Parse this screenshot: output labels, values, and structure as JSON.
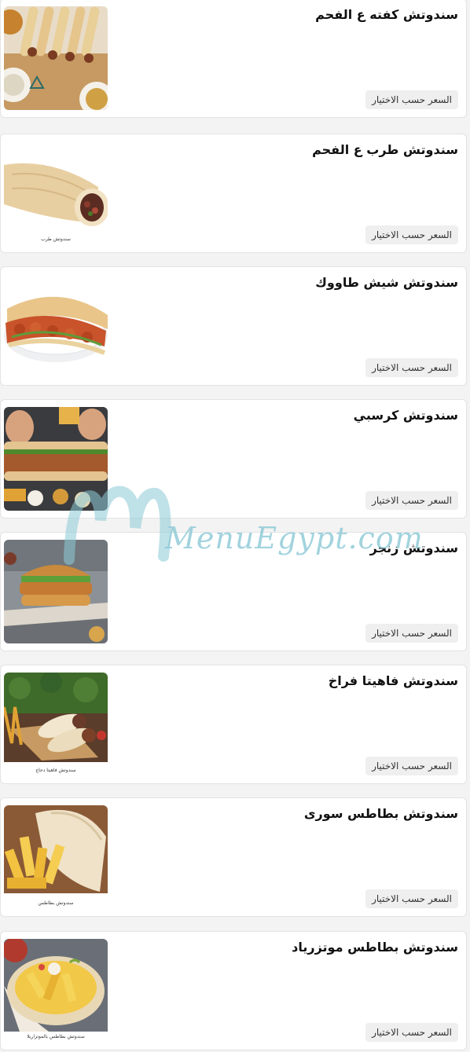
{
  "items": [
    {
      "name": "سندوتش كفته ع الفحم",
      "price_label": "السعر حسب الاختيار",
      "image": "kofta-grill-image",
      "caption": ""
    },
    {
      "name": "سندوتش طرب ع الفحم",
      "price_label": "السعر حسب الاختيار",
      "image": "tarb-wrap-image",
      "caption": "سندوتش طرب"
    },
    {
      "name": "سندوتش شيش طاووك",
      "price_label": "السعر حسب الاختيار",
      "image": "shish-tawook-image",
      "caption": ""
    },
    {
      "name": "سندوتش كرسبي",
      "price_label": "السعر حسب الاختيار",
      "image": "crispy-sandwich-image",
      "caption": ""
    },
    {
      "name": "سندوتش زنجر",
      "price_label": "السعر حسب الاختيار",
      "image": "zinger-burger-image",
      "caption": ""
    },
    {
      "name": "سندوتش فاهيتا فراخ",
      "price_label": "السعر حسب الاختيار",
      "image": "chicken-fajita-image",
      "caption": "سندوتش فاهيتا دجاج"
    },
    {
      "name": "سندوتش بطاطس سورى",
      "price_label": "السعر حسب الاختيار",
      "image": "syrian-fries-wrap-image",
      "caption": "سندوتش بطاطس"
    },
    {
      "name": "سندوتش بطاطس موتزرياد",
      "price_label": "السعر حسب الاختيار",
      "image": "fries-mozzarella-image",
      "caption": "سندوتش بطاطس بالموتزاريلا"
    }
  ],
  "watermark": {
    "text": "MenuEgypt.com",
    "color": "#8cc9d6"
  }
}
